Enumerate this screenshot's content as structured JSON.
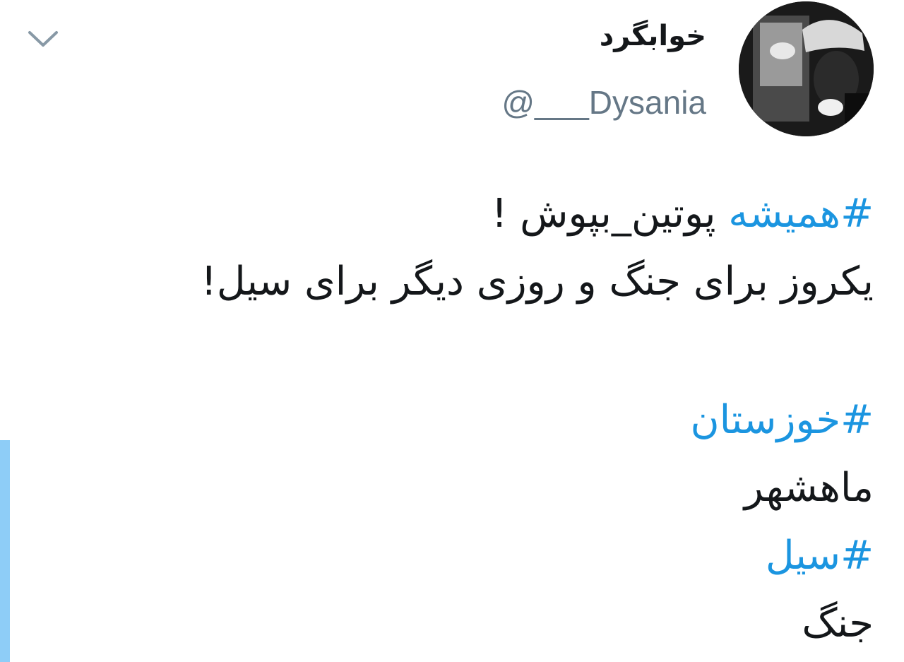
{
  "tweet": {
    "author": {
      "display_name": "خوابگرد",
      "handle": "@___Dysania"
    },
    "lines": [
      {
        "hashtag": "#همیشه",
        "text": " پوتین_بپوش !"
      },
      {
        "hashtag": "",
        "text": "یکروز برای جنگ و روزی دیگر برای سیل!"
      },
      {
        "hashtag": "#خوزستان",
        "text": ""
      },
      {
        "hashtag": "",
        "text": "ماهشهر"
      },
      {
        "hashtag": "#سیل",
        "text": ""
      },
      {
        "hashtag": "",
        "text": "جنگ"
      }
    ]
  },
  "icons": {
    "menu": "chevron-down-icon",
    "avatar": "avatar-image"
  },
  "colors": {
    "hashtag": "#1b95e0",
    "handle": "#657786",
    "text": "#14171a",
    "side_bar": "#8ecdf7"
  }
}
